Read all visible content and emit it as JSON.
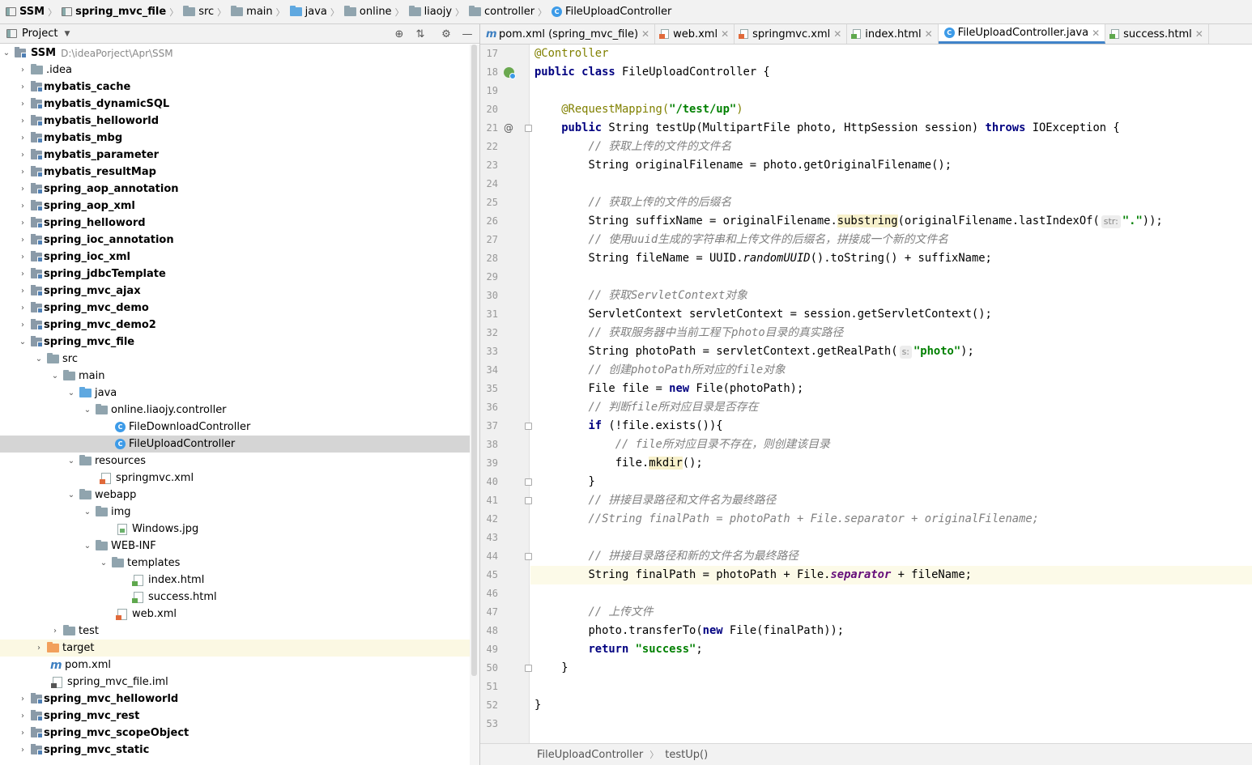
{
  "navbar": {
    "crumbs": [
      "SSM",
      "spring_mvc_file",
      "src",
      "main",
      "java",
      "online",
      "liaojy",
      "controller",
      "FileUploadController"
    ]
  },
  "project_panel": {
    "title": "Project"
  },
  "tree": {
    "root_name": "SSM",
    "root_path": "D:\\ideaPorject\\Apr\\SSM",
    "nodes": [
      ".idea",
      "mybatis_cache",
      "mybatis_dynamicSQL",
      "mybatis_helloworld",
      "mybatis_mbg",
      "mybatis_parameter",
      "mybatis_resultMap",
      "spring_aop_annotation",
      "spring_aop_xml",
      "spring_helloword",
      "spring_ioc_annotation",
      "spring_ioc_xml",
      "spring_jdbcTemplate",
      "spring_mvc_ajax",
      "spring_mvc_demo",
      "spring_mvc_demo2",
      "spring_mvc_file",
      "src",
      "main",
      "java",
      "online.liaojy.controller",
      "FileDownloadController",
      "FileUploadController",
      "resources",
      "springmvc.xml",
      "webapp",
      "img",
      "Windows.jpg",
      "WEB-INF",
      "templates",
      "index.html",
      "success.html",
      "web.xml",
      "test",
      "target",
      "pom.xml",
      "spring_mvc_file.iml",
      "spring_mvc_helloworld",
      "spring_mvc_rest",
      "spring_mvc_scopeObject",
      "spring_mvc_static"
    ]
  },
  "tabs": [
    "pom.xml (spring_mvc_file)",
    "web.xml",
    "springmvc.xml",
    "index.html",
    "FileUploadController.java",
    "success.html"
  ],
  "editor": {
    "line_numbers": [
      "17",
      "18",
      "19",
      "20",
      "21",
      "22",
      "23",
      "24",
      "25",
      "26",
      "27",
      "28",
      "29",
      "30",
      "31",
      "32",
      "33",
      "34",
      "35",
      "36",
      "37",
      "38",
      "39",
      "40",
      "41",
      "42",
      "43",
      "44",
      "45",
      "46",
      "47",
      "48",
      "49",
      "50",
      "51",
      "52",
      "53"
    ],
    "gutter_at": "@",
    "hints": {
      "str": "str:",
      "s": "s:"
    },
    "code": {
      "l17": "@Controller",
      "l18a": "public class",
      "l18b": " FileUploadController {",
      "l20a": "@RequestMapping(",
      "l20b": "\"/test/up\"",
      "l20c": ")",
      "l21a": "public",
      "l21b": " String testUp(MultipartFile photo, HttpSession session) ",
      "l21c": "throws",
      "l21d": " IOException {",
      "l22": "// 获取上传的文件的文件名",
      "l23": "String originalFilename = photo.getOriginalFilename();",
      "l25": "// 获取上传的文件的后缀名",
      "l26a": "String suffixName = originalFilename.",
      "l26b": "substring",
      "l26c": "(originalFilename.lastIndexOf(",
      "l26d": "\".\"",
      "l26e": "));",
      "l27": "// 使用uuid生成的字符串和上传文件的后缀名，拼接成一个新的文件名",
      "l28a": "String fileName = UUID.",
      "l28b": "randomUUID",
      "l28c": "().toString() + suffixName;",
      "l30": "// 获取ServletContext对象",
      "l31": "ServletContext servletContext = session.getServletContext();",
      "l32": "// 获取服务器中当前工程下photo目录的真实路径",
      "l33a": "String photoPath = servletContext.getRealPath(",
      "l33b": "\"photo\"",
      "l33c": ");",
      "l34": "// 创建photoPath所对应的file对象",
      "l35a": "File file = ",
      "l35b": "new",
      "l35c": " File(photoPath);",
      "l36": "// 判断file所对应目录是否存在",
      "l37a": "if",
      "l37b": " (!file.exists()){",
      "l38": "// file所对应目录不存在，则创建该目录",
      "l39a": "file.",
      "l39b": "mkdir",
      "l39c": "();",
      "l40": "}",
      "l41": "// 拼接目录路径和文件名为最终路径",
      "l42": "//String finalPath = photoPath + File.separator + originalFilename;",
      "l44": "// 拼接目录路径和新的文件名为最终路径",
      "l45a": "String finalPath = photoPath + File.",
      "l45b": "separator",
      "l45c": " + fileName;",
      "l47": "// 上传文件",
      "l48a": "photo.transferTo(",
      "l48b": "new",
      "l48c": " File(finalPath));",
      "l49a": "return",
      "l49b": "\"success\"",
      "l49c": ";",
      "l50": "}",
      "l52": "}"
    }
  },
  "editor_footer": {
    "crumbs": [
      "FileUploadController",
      "testUp()"
    ]
  }
}
